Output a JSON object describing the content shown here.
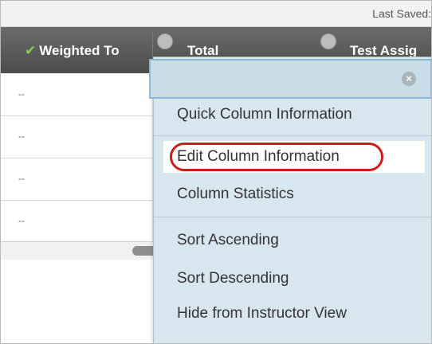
{
  "topbar": {
    "last_saved": "Last Saved:/"
  },
  "header": {
    "columns": [
      "Weighted To",
      "Total",
      "Test Assig"
    ],
    "check_icon": "✔"
  },
  "grid": {
    "rows": [
      "--",
      "--",
      "--",
      "--"
    ]
  },
  "menu": {
    "close_icon": "×",
    "items": [
      "Quick Column Information",
      "Edit Column Information",
      "Column Statistics",
      "Sort Ascending",
      "Sort Descending",
      "Hide from Instructor View"
    ],
    "highlighted_index": 1,
    "highlight_color": "#d11a1a"
  }
}
